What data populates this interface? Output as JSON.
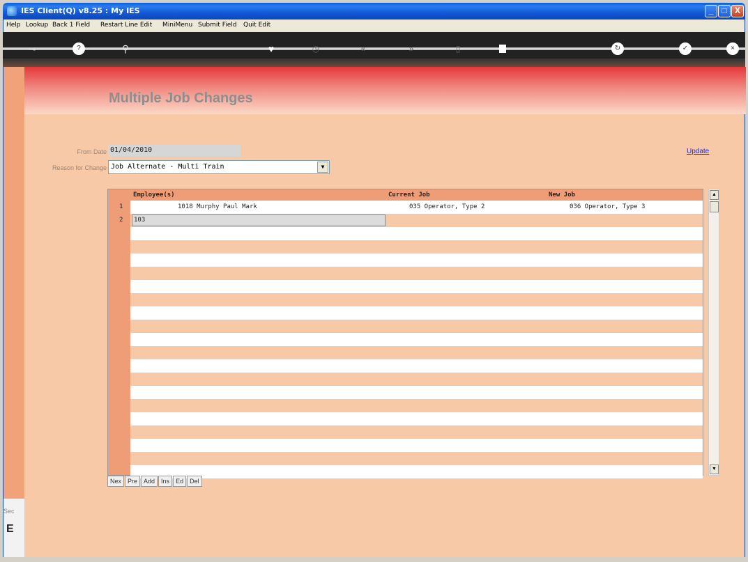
{
  "window": {
    "title": "IES Client(Q) v8.25 : My IES",
    "minimize": "_",
    "maximize": "□",
    "close": "X"
  },
  "menu": {
    "items": [
      "Help",
      "Lookup",
      "Back 1 Field",
      "Restart Line Edit",
      "MiniMenu",
      "Submit Field",
      "Quit Edit"
    ]
  },
  "toolbar": {
    "icons": [
      "key-icon",
      "help-icon",
      "search-icon",
      "heart-icon",
      "clock-icon",
      "rewind-icon",
      "forward-icon",
      "lock-icon",
      "stop-icon",
      "refresh-icon",
      "check-icon",
      "close-icon"
    ]
  },
  "page": {
    "title": "Multiple Job Changes"
  },
  "form": {
    "from_date_label": "From Date",
    "from_date_value": "01/04/2010",
    "reason_label": "Reason for Change",
    "reason_value": "Job Alternate - Multi Train",
    "update_link": "Update"
  },
  "grid": {
    "headers": {
      "employee": "Employee(s)",
      "current_job": "Current Job",
      "new_job": "New Job"
    },
    "rows": [
      {
        "num": "1",
        "employee": "1018 Murphy Paul Mark",
        "current_job": "035 Operator, Type 2",
        "new_job": "036 Operator, Type 3"
      },
      {
        "num": "2",
        "employee_input": "103"
      }
    ]
  },
  "grid_buttons": [
    "Nex",
    "Pre",
    "Add",
    "Ins",
    "Ed",
    "Del"
  ],
  "side": {
    "sec_label": "Sec",
    "big_char": "E"
  }
}
